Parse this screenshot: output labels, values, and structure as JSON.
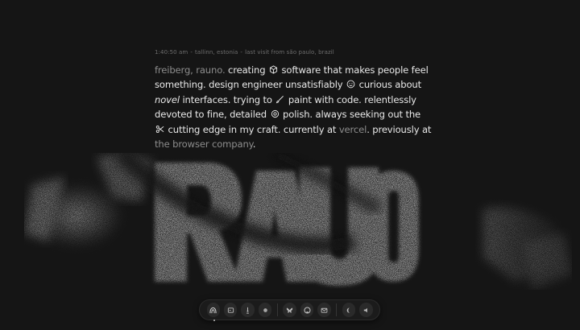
{
  "meta": {
    "time": "1:40:50 am",
    "location": "tallinn, estonia",
    "last_visit": "last visit from são paulo, brazil"
  },
  "bio": {
    "name": "freiberg, rauno.",
    "p1": " creating ",
    "p2": " software that makes people feel something. design engineer unsatisfiably ",
    "p3": " curious about ",
    "p3b": "novel",
    "p3c": " interfaces. trying to ",
    "p4": " paint with code. relentlessly devoted to fine, detailed ",
    "p5": " polish. always seeking out the ",
    "p6": " cutting edge in my craft. currently at ",
    "company_current": "vercel",
    "p7": ". previously at ",
    "company_previous": "the browser company",
    "p8": "."
  },
  "art": {
    "word": "RAUNO"
  },
  "dock": {
    "items": [
      {
        "name": "home-icon"
      },
      {
        "name": "craft-icon"
      },
      {
        "name": "lamp-icon"
      },
      {
        "name": "dot-icon"
      },
      {
        "name": "bluesky-icon"
      },
      {
        "name": "github-icon"
      },
      {
        "name": "mail-icon"
      },
      {
        "name": "moon-icon"
      },
      {
        "name": "sound-icon"
      }
    ]
  }
}
